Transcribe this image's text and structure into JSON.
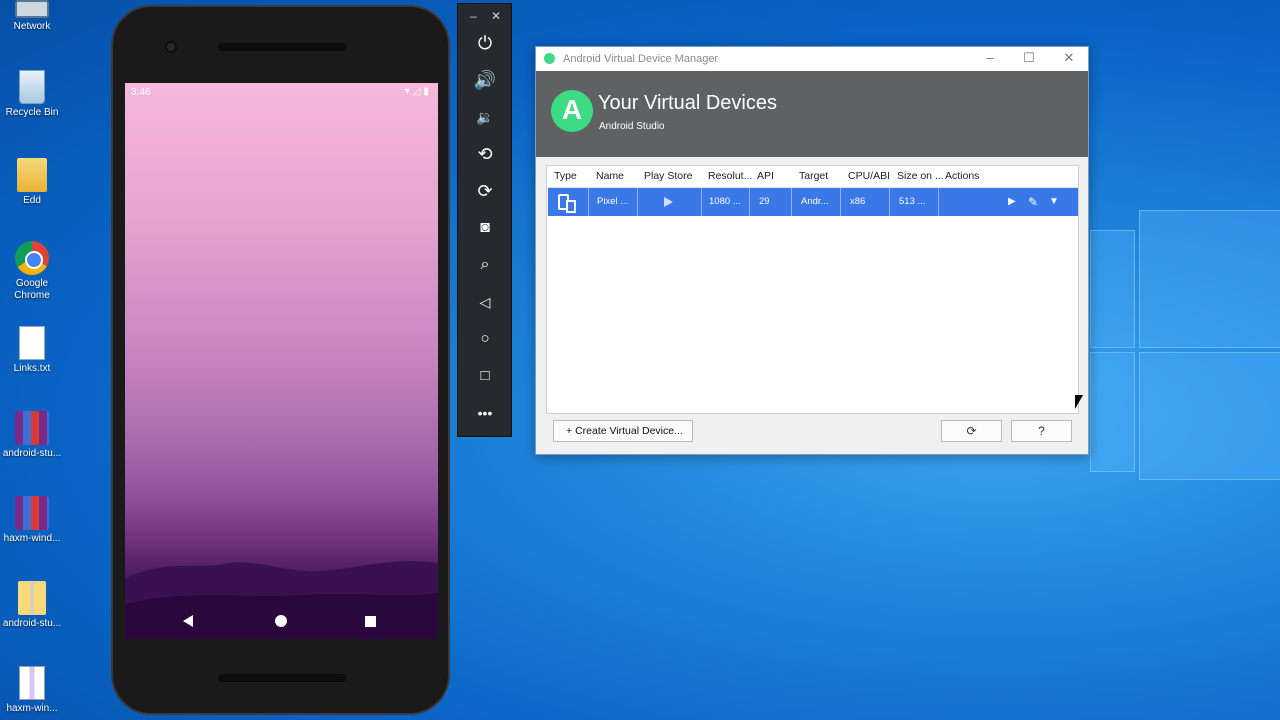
{
  "desktop": {
    "icons": [
      {
        "label": "Network",
        "icon": "network-icon"
      },
      {
        "label": "Recycle Bin",
        "icon": "recycle-bin-icon"
      },
      {
        "label": "Edd",
        "icon": "user-folder-icon"
      },
      {
        "label": "Google Chrome",
        "icon": "chrome-icon"
      },
      {
        "label": "Links.txt",
        "icon": "text-file-icon"
      },
      {
        "label": "android-stu...",
        "icon": "winrar-archive-icon"
      },
      {
        "label": "haxm-wind...",
        "icon": "winrar-archive-icon"
      },
      {
        "label": "android-stu...",
        "icon": "zip-folder-icon"
      },
      {
        "label": "haxm-win...",
        "icon": "zip-file-icon"
      }
    ]
  },
  "emulator": {
    "status_time": "3:46",
    "toolbar": {
      "minimize": "–",
      "close": "✕",
      "buttons": [
        "power-icon",
        "volume-up-icon",
        "volume-down-icon",
        "rotate-left-icon",
        "rotate-right-icon",
        "camera-icon",
        "zoom-icon",
        "back-icon",
        "home-icon",
        "overview-icon",
        "more-icon"
      ]
    }
  },
  "avd_manager": {
    "window_title": "Android Virtual Device Manager",
    "heading": "Your Virtual Devices",
    "subheading": "Android Studio",
    "columns": [
      "Type",
      "Name",
      "Play Store",
      "Resolut...",
      "API",
      "Target",
      "CPU/ABI",
      "Size on ...",
      "Actions"
    ],
    "rows": [
      {
        "type_icon": "phone-tablet-icon",
        "name": "Pixel ...",
        "play_store_icon": "play-store-icon",
        "resolution": "1080 ...",
        "api": "29",
        "target": "Andr...",
        "cpu_abi": "x86",
        "size_on_disk": "513 ...",
        "actions": [
          "launch-icon",
          "edit-icon",
          "dropdown-icon"
        ]
      }
    ],
    "create_button": "Create Virtual Device...",
    "create_button_icon": "+",
    "refresh_icon": "⟳",
    "help_label": "?",
    "colors": {
      "selection": "#3b78e7",
      "header_bg": "#5f6163",
      "android_green": "#3ddc84"
    }
  }
}
